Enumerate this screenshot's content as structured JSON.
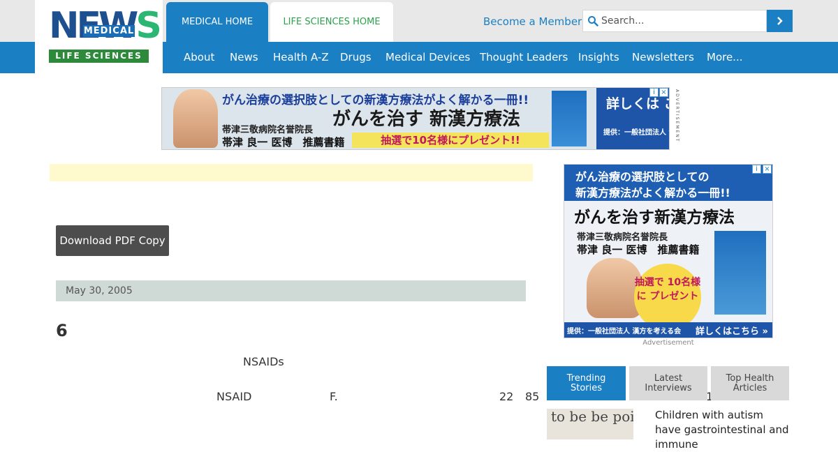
{
  "logo": {
    "word_left": "NEW",
    "word_right": "S",
    "medical": "MEDICAL",
    "life": "LIFE SCIENCES"
  },
  "tabs": {
    "medical_home": "MEDICAL HOME",
    "life_home": "LIFE SCIENCES HOME"
  },
  "header": {
    "member_link": "Become a Member",
    "search_placeholder": "Search..."
  },
  "nav": {
    "items": [
      "About",
      "News",
      "Health A-Z",
      "Drugs",
      "Medical Devices",
      "Thought Leaders",
      "Insights",
      "Newsletters",
      "More..."
    ]
  },
  "banner_ad": {
    "headline1": "がん治療の選択肢としての新漢方療法がよく解かる一冊!!",
    "headline2": "がんを治す 新漢方療法",
    "sub1": "帯津三敬病院名誉院長",
    "sub2": "帯津 良一 医博　推薦書籍",
    "prize": "抽選で10名様にプレゼント!!",
    "cta": "詳しくは こちら »",
    "provider": "提供：一般社団法人 漢方を考える会",
    "vertical_label": "ADVERTISEMENT"
  },
  "article": {
    "pdf_button": "Download PDF Copy",
    "date": "May 30, 2005",
    "headline": "6",
    "words": [
      "NSAIDs",
      "NSAID",
      "F.",
      "22",
      "85",
      "1"
    ]
  },
  "side_ad": {
    "line1": "がん治療の選択肢としての",
    "line2": "新漢方療法がよく解かる一冊!!",
    "big": "がんを治す新漢方療法",
    "sub1": "帯津三敬病院名誉院長",
    "sub2": "帯津 良一 医博　推薦書籍",
    "badge": "抽選で 10名様に プレゼント",
    "provider": "提供：一般社団法人 漢方を考える会",
    "cta": "詳しくはこちら »",
    "label": "Advertisement"
  },
  "side_tabs": [
    "Trending Stories",
    "Latest Interviews",
    "Top Health Articles"
  ],
  "story": {
    "thumb_text": "to be be point of v",
    "title": "Children with autism have gastrointestinal and immune"
  },
  "colors": {
    "brand_blue": "#1b7fc4",
    "brand_green": "#2aa14b",
    "notice": "#fffacd"
  }
}
